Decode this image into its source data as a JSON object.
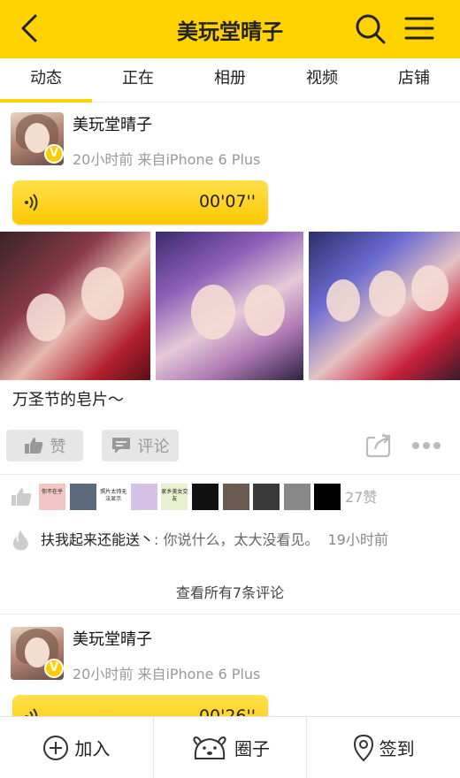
{
  "header": {
    "title": "美玩堂晴子"
  },
  "tabs": [
    "动态",
    "正在",
    "相册",
    "视频",
    "店铺"
  ],
  "posts": [
    {
      "author": "美玩堂晴子",
      "badge": "V",
      "meta": "20小时前   来自iPhone 6 Plus",
      "voice_duration": "00'07''",
      "caption": "万圣节的皂片～",
      "like_label": "赞",
      "comment_label": "评论",
      "like_count": "27赞",
      "comment": {
        "name": "扶我起来还能送丶",
        "text": ": 你说什么，太大没看见。",
        "time": "19小时前"
      },
      "view_all": "查看所有7条评论"
    },
    {
      "author": "美玩堂晴子",
      "badge": "V",
      "meta": "20小时前   来自iPhone 6 Plus",
      "voice_duration": "00'26''"
    }
  ],
  "liker_avatars": [
    {
      "text": "你不在乎",
      "color": "#f3c6c6"
    },
    {
      "text": "",
      "color": "#5a6a7a"
    },
    {
      "text": "照片太帅无法显示",
      "color": "#ffffff"
    },
    {
      "text": "",
      "color": "#d6c2e6"
    },
    {
      "text": "家乡美女交友",
      "color": "#e8f0d0"
    },
    {
      "text": "",
      "color": "#111111"
    },
    {
      "text": "",
      "color": "#6a5a50"
    },
    {
      "text": "",
      "color": "#3a3a3a"
    },
    {
      "text": "",
      "color": "#888888"
    },
    {
      "text": "",
      "color": "#000000"
    }
  ],
  "bottom": {
    "join": "加入",
    "circle": "圈子",
    "checkin": "签到"
  },
  "colors": {
    "accent": "#ffd200",
    "muted": "#999999"
  }
}
